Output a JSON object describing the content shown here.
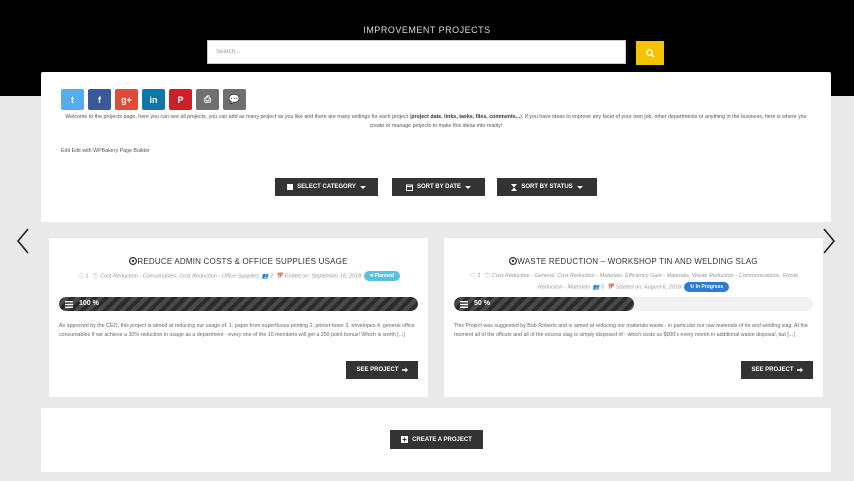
{
  "header": {
    "title": "IMPROVEMENT PROJECTS",
    "search_placeholder": "Search..."
  },
  "social": [
    {
      "icon": "twitter-icon",
      "glyph": "t",
      "color": "#55acee"
    },
    {
      "icon": "facebook-icon",
      "glyph": "f",
      "color": "#3b5998"
    },
    {
      "icon": "google-plus-icon",
      "glyph": "g+",
      "color": "#dd4b39"
    },
    {
      "icon": "linkedin-icon",
      "glyph": "in",
      "color": "#0e76a8"
    },
    {
      "icon": "pinterest-icon",
      "glyph": "P",
      "color": "#cb2027"
    },
    {
      "icon": "print-icon",
      "glyph": "⎙",
      "color": "#6f6f6f"
    },
    {
      "icon": "comment-icon",
      "glyph": "💬",
      "color": "#6f6f6f"
    }
  ],
  "intro": {
    "text_start": "Welcome to the projects page, here you can see all projects, you can add as many project as you like and there are many settings for each project (",
    "text_bold": "project date, links, tasks, files, comments...",
    "text_end": "). If you have ideas to improve any facet of your own job, other departments or anything in the business, here is where you create or manage projects to make this ideas into reality!",
    "edit_link": "Edit Edit with WPBakery Page Builder"
  },
  "filters": {
    "category": "SELECT CATEGORY",
    "date": "SORT BY DATE",
    "status": "SORT BY STATUS"
  },
  "projects": [
    {
      "title": "REDUCE ADMIN COSTS & OFFICE SUPPLIES USAGE",
      "comments": "1",
      "categories": "Cost Reduction - Consumables, Cost Reduction - Office Supplies",
      "members": "2",
      "date_text": "Ended on: September 18, 2018",
      "status": "Planned",
      "status_color": "#5bc0de",
      "progress_label": "100 %",
      "progress": 100,
      "description": "As approved by the CEO, this project is aimed at reducing our usage of: 1. paper from superfluous printing 2. printer toner 3. envelopes 4. general office consumables If we achieve a 30% reduction in usage as a department - every one of the 10 members will get a 250 point bonus! Which is worth [...]",
      "button": "SEE PROJECT"
    },
    {
      "title": "WASTE REDUCTION – WORKSHOP TIN AND WELDING SLAG",
      "comments": "2",
      "categories": "Cost Reduction - General, Cost Reduction - Materials, Efficiency Gain - Materials, Waste Reduction - Communications, Waste Reduction - Materials",
      "members": "5",
      "date_text": "Started on: August 6, 2018",
      "status": "In Progress",
      "status_color": "#2e7bd6",
      "progress_label": "50 %",
      "progress": 50,
      "description": "This Project was suggested by Bob Roberts and is aimed at reducing our materials waste - in particular our raw materials of tin and welding slag. At the moment all of the offcuts and all of the excess slag is simply disposed of - which costs us $000's every month in additional waste disposal, but [...]",
      "button": "SEE PROJECT"
    }
  ],
  "create_button": "CREATE A PROJECT"
}
